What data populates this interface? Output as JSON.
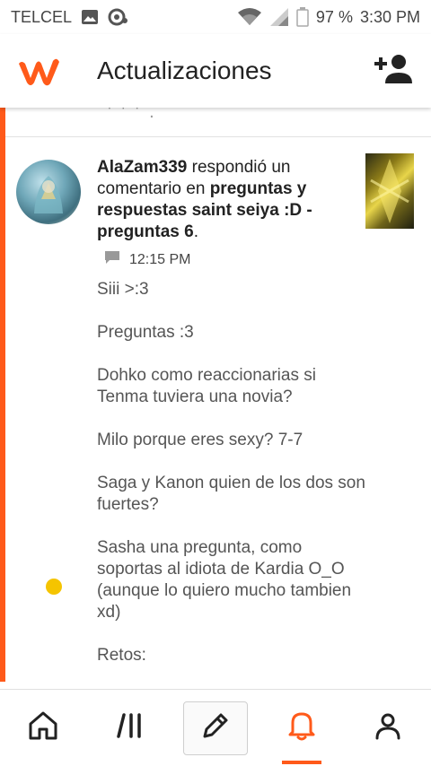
{
  "status_bar": {
    "carrier": "TELCEL",
    "battery": "97 %",
    "time": "3:30 PM"
  },
  "app_bar": {
    "title": "Actualizaciones",
    "logo_icon": "wattpad-logo",
    "action_icon": "add-user-icon"
  },
  "previous_item_peek": "' ' ' .",
  "notification": {
    "username": "AlaZam339",
    "action_1": " respondió un comentario en ",
    "story": "preguntas y respuestas saint seiya :D - preguntas 6",
    "end": ".",
    "time": "12:15 PM",
    "comment_lines": [
      "Siii >:3",
      "Preguntas :3",
      "Dohko como reaccionarias si Tenma tuviera una novia?",
      "Milo porque eres sexy? 7-7",
      "Saga y Kanon quien de los dos son fuertes?",
      "Sasha una pregunta, como soportas al idiota de Kardia O_O (aunque lo quiero mucho tambien xd)",
      "Retos:"
    ]
  },
  "bottom_nav": {
    "items": [
      "home-icon",
      "library-icon",
      "write-icon",
      "notifications-icon",
      "profile-icon"
    ],
    "active": "notifications-icon"
  },
  "colors": {
    "accent": "#ff5a1a",
    "unread_dot": "#f5c400"
  }
}
